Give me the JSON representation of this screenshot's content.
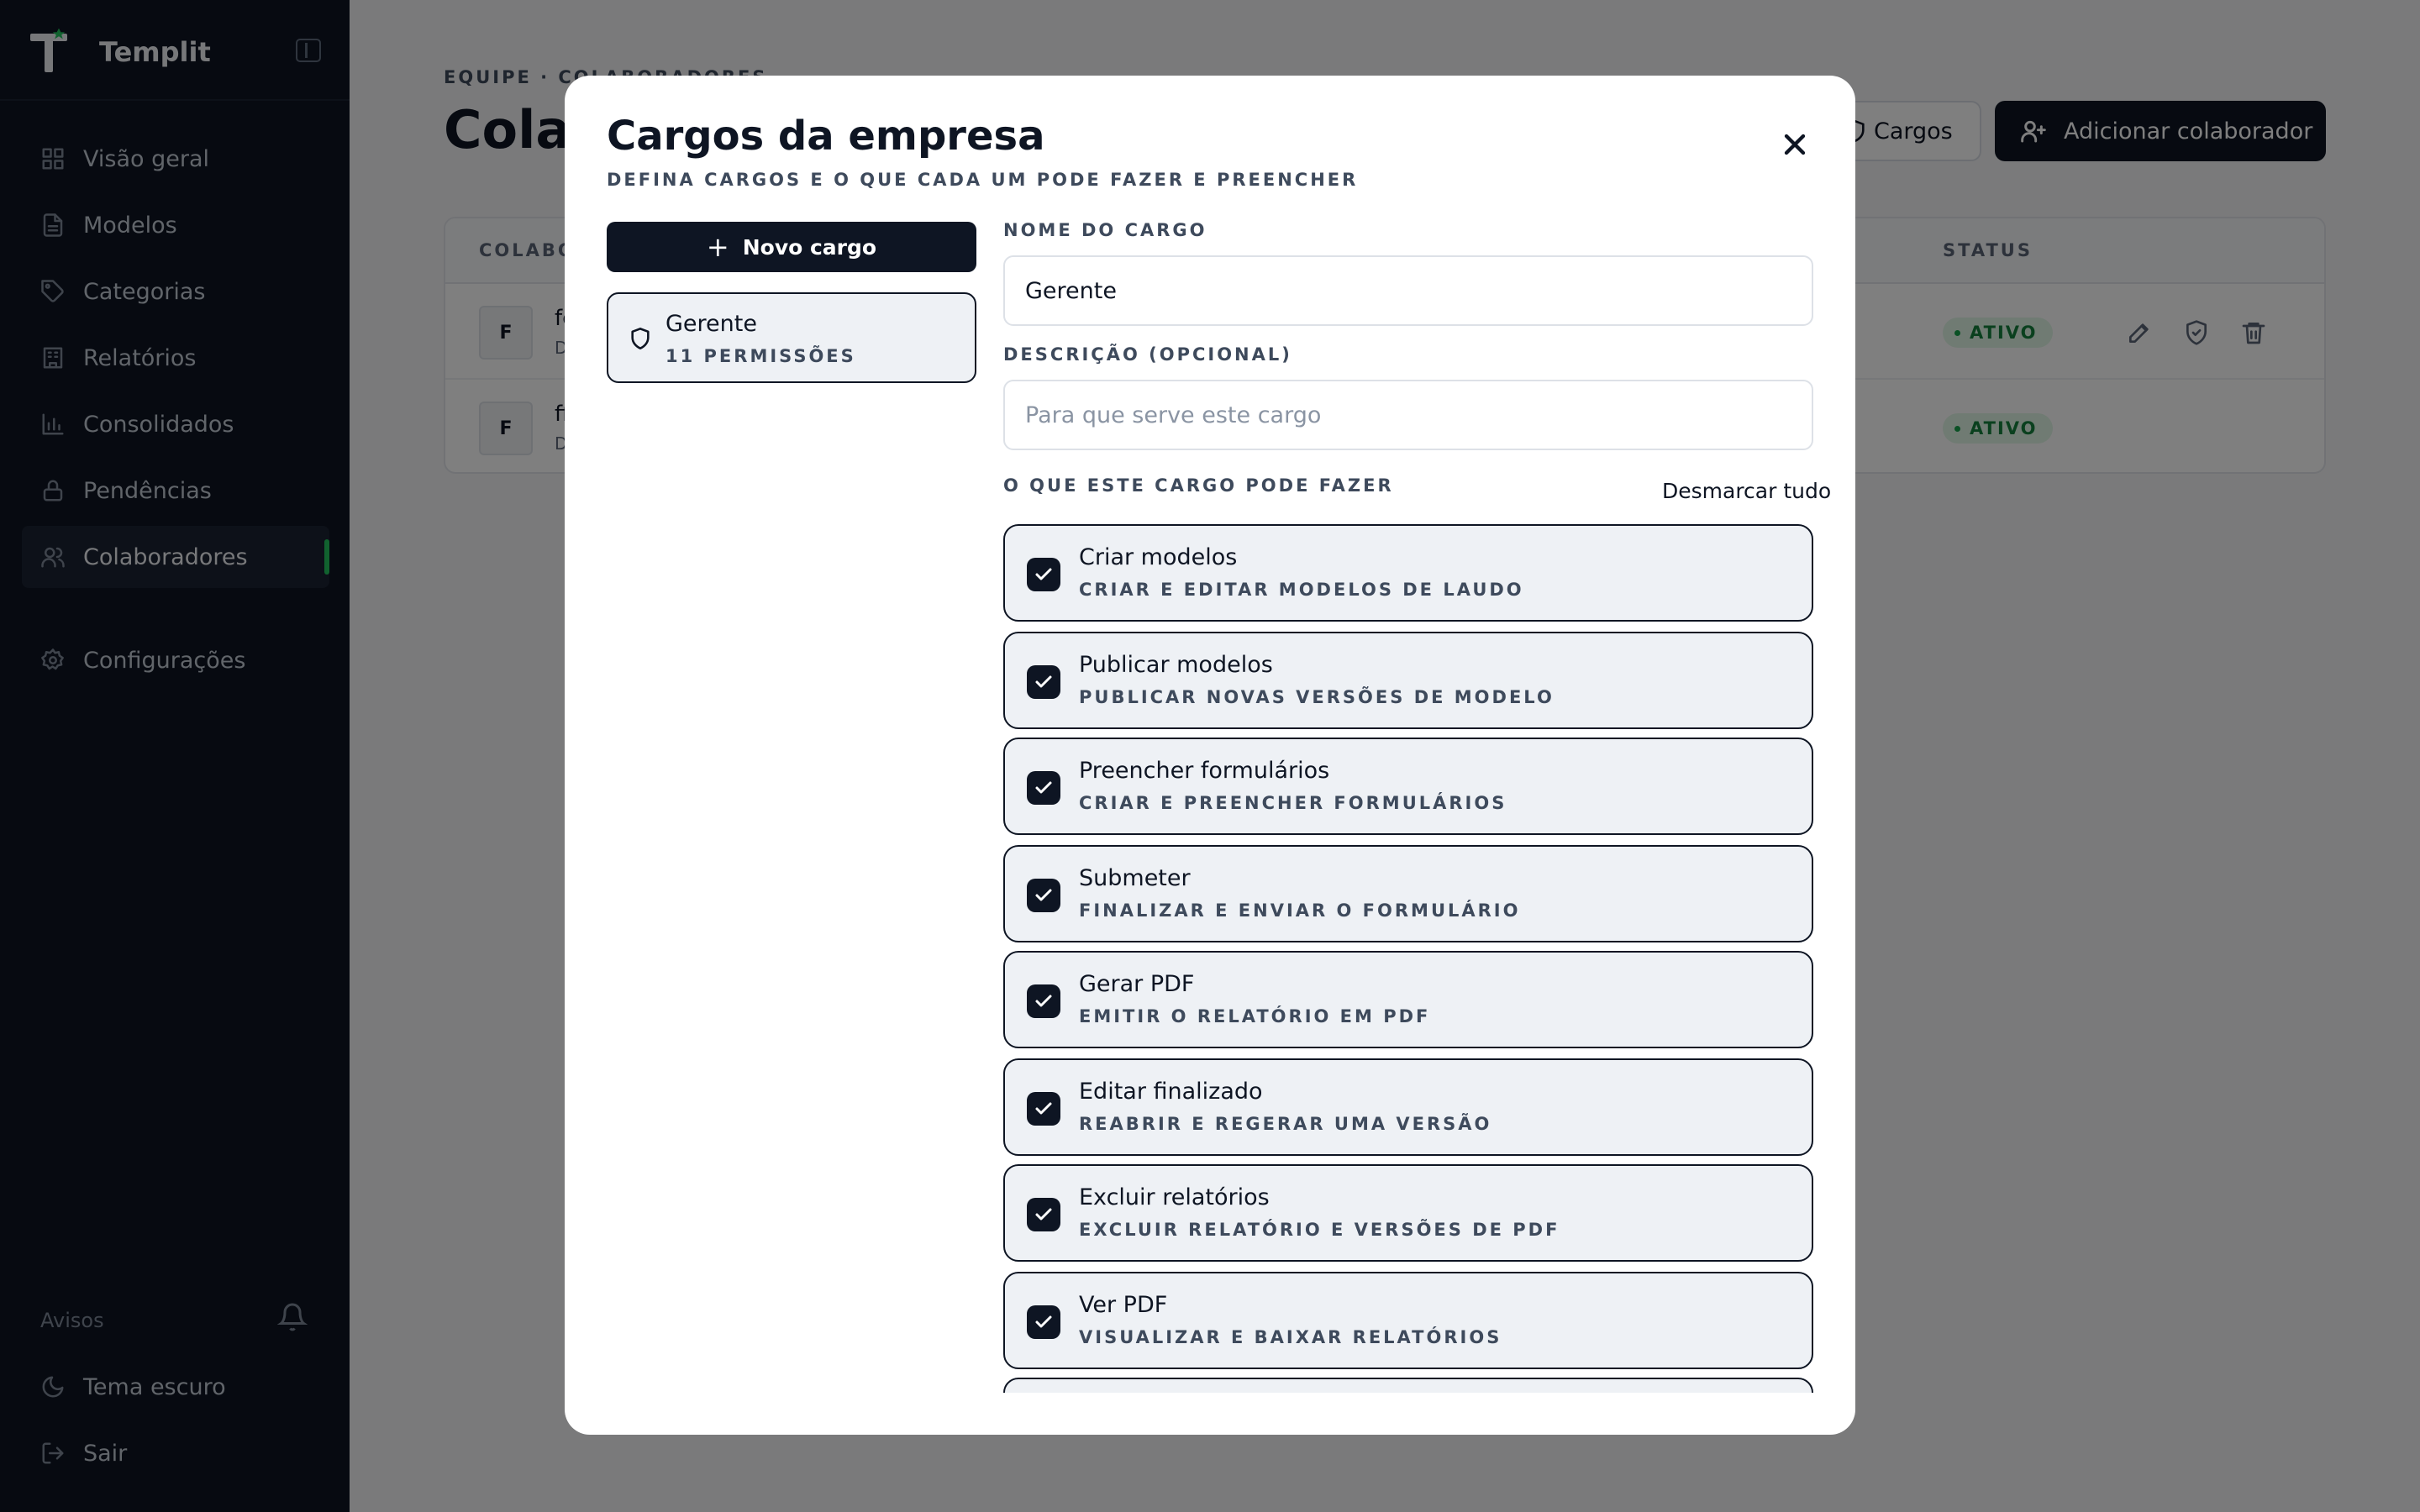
{
  "sidebar": {
    "app_name": "Templit",
    "logo_accent_color": "#22c55e",
    "nav": [
      {
        "label": "Visão geral",
        "icon": "grid-icon"
      },
      {
        "label": "Modelos",
        "icon": "file-icon"
      },
      {
        "label": "Categorias",
        "icon": "tag-icon"
      },
      {
        "label": "Relatórios",
        "icon": "building-icon"
      },
      {
        "label": "Consolidados",
        "icon": "bar-chart-icon"
      },
      {
        "label": "Pendências",
        "icon": "lock-icon"
      },
      {
        "label": "Colaboradores",
        "icon": "users-icon",
        "active": true
      },
      {
        "label": "Configurações",
        "icon": "gear-icon"
      }
    ],
    "notices_label": "Avisos",
    "dark_theme_label": "Tema escuro",
    "logout_label": "Sair"
  },
  "page": {
    "breadcrumb": "EQUIPE · COLABORADORES",
    "title": "Colaboradores",
    "cargos_button": "Cargos",
    "add_button": "Adicionar colaborador",
    "table": {
      "headers": {
        "collaborator": "COLABORADOR",
        "status": "STATUS"
      },
      "rows": [
        {
          "initial": "F",
          "name": "fe",
          "sub": "D",
          "status": "ATIVO"
        },
        {
          "initial": "F",
          "name": "ff",
          "sub": "D",
          "status": "ATIVO"
        }
      ]
    }
  },
  "modal": {
    "title": "Cargos da empresa",
    "subtitle": "DEFINA CARGOS E O QUE CADA UM PODE FAZER E PREENCHER",
    "new_role_button": "Novo cargo",
    "roles": [
      {
        "name": "Gerente",
        "count": "11 PERMISSÕES"
      }
    ],
    "name_label": "NOME DO CARGO",
    "name_value": "Gerente",
    "desc_label": "DESCRIÇÃO (OPCIONAL)",
    "desc_placeholder": "Para que serve este cargo",
    "perms_label": "O QUE ESTE CARGO PODE FAZER",
    "unmark_all": "Desmarcar tudo",
    "permissions": [
      {
        "title": "Criar modelos",
        "desc": "CRIAR E EDITAR MODELOS DE LAUDO",
        "checked": true
      },
      {
        "title": "Publicar modelos",
        "desc": "PUBLICAR NOVAS VERSÕES DE MODELO",
        "checked": true
      },
      {
        "title": "Preencher formulários",
        "desc": "CRIAR E PREENCHER FORMULÁRIOS",
        "checked": true
      },
      {
        "title": "Submeter",
        "desc": "FINALIZAR E ENVIAR O FORMULÁRIO",
        "checked": true
      },
      {
        "title": "Gerar PDF",
        "desc": "EMITIR O RELATÓRIO EM PDF",
        "checked": true
      },
      {
        "title": "Editar finalizado",
        "desc": "REABRIR E REGERAR UMA VERSÃO",
        "checked": true
      },
      {
        "title": "Excluir relatórios",
        "desc": "EXCLUIR RELATÓRIO E VERSÕES DE PDF",
        "checked": true
      },
      {
        "title": "Ver PDF",
        "desc": "VISUALIZAR E BAIXAR RELATÓRIOS",
        "checked": true
      }
    ]
  }
}
